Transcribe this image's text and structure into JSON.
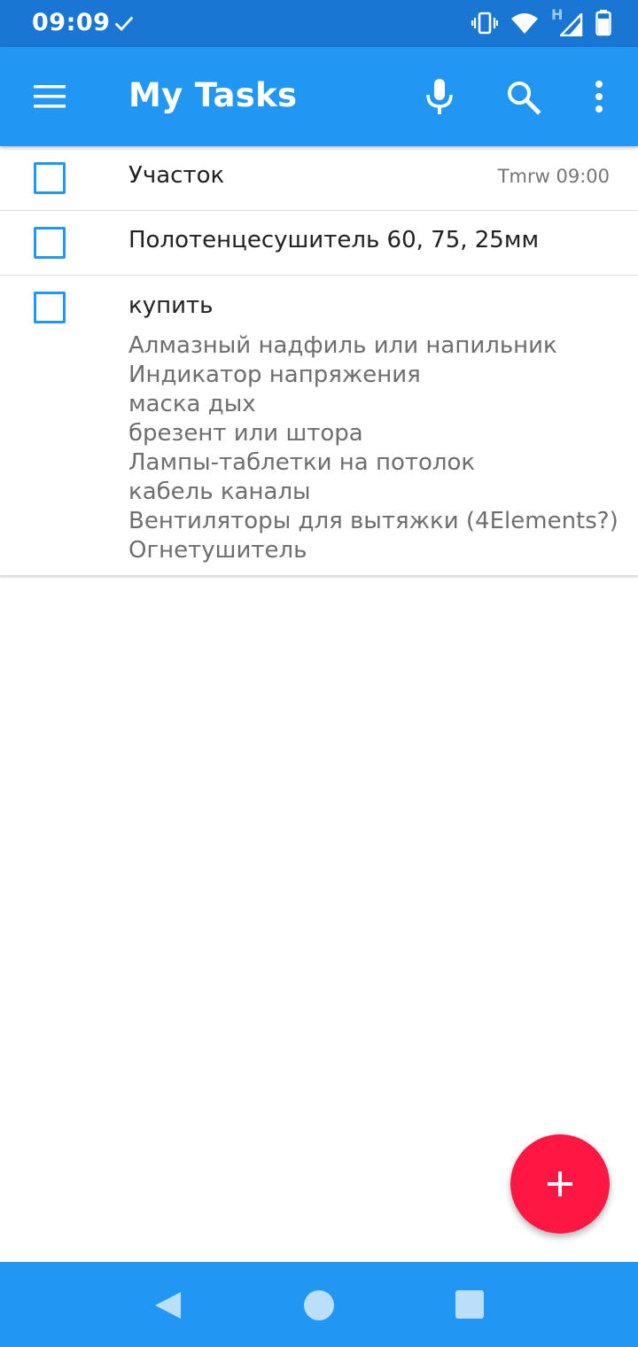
{
  "status_bar": {
    "time": "09:09",
    "network_label": "H",
    "icons": [
      "check-icon",
      "vibrate-icon",
      "wifi-icon",
      "signal-icon",
      "battery-icon"
    ]
  },
  "app_bar": {
    "title": "My Tasks",
    "icons": [
      "menu-icon",
      "mic-icon",
      "search-icon",
      "more-vert-icon"
    ]
  },
  "tasks": [
    {
      "title": "Участок",
      "due": "Tmrw 09:00",
      "completed": false,
      "notes": []
    },
    {
      "title": "Полотенцесушитель 60, 75, 25мм",
      "due": "",
      "completed": false,
      "notes": []
    },
    {
      "title": "купить",
      "due": "",
      "completed": false,
      "notes": [
        "Алмазный надфиль или напильник",
        "Индикатор напряжения",
        "маска дых",
        "брезент или штора",
        "Лампы-таблетки на потолок",
        "кабель каналы",
        "Вентиляторы для вытяжки (4Elements?)",
        "Огнетушитель"
      ]
    }
  ],
  "fab": {
    "icon": "plus-icon"
  },
  "colors": {
    "status_bar": "#1976d2",
    "app_bar": "#2196f3",
    "checkbox": "#2196f3",
    "fab": "#ff1744"
  }
}
